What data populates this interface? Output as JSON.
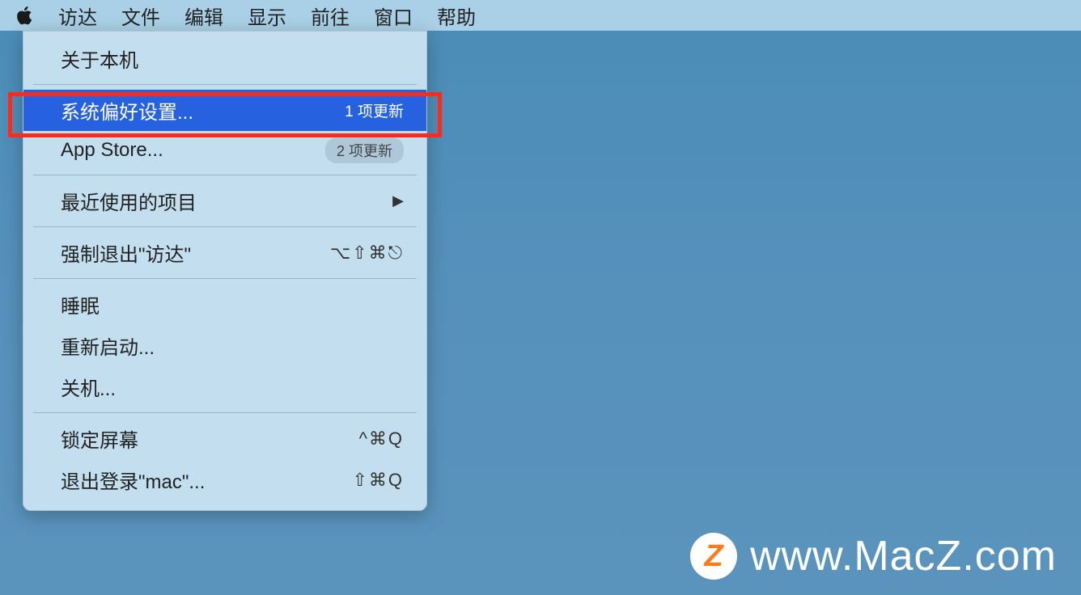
{
  "menubar": {
    "items": [
      "访达",
      "文件",
      "编辑",
      "显示",
      "前往",
      "窗口",
      "帮助"
    ]
  },
  "apple_menu": {
    "about": "关于本机",
    "system_prefs": "系统偏好设置...",
    "system_prefs_badge": "1 项更新",
    "app_store": "App Store...",
    "app_store_badge": "2 项更新",
    "recent_items": "最近使用的项目",
    "force_quit": "强制退出\"访达\"",
    "force_quit_shortcut": "⌥⇧⌘⎋",
    "sleep": "睡眠",
    "restart": "重新启动...",
    "shutdown": "关机...",
    "lock_screen": "锁定屏幕",
    "lock_screen_shortcut": "^⌘Q",
    "logout": "退出登录\"mac\"...",
    "logout_shortcut": "⇧⌘Q"
  },
  "watermark": {
    "badge": "Z",
    "url": "www.MacZ.com"
  }
}
